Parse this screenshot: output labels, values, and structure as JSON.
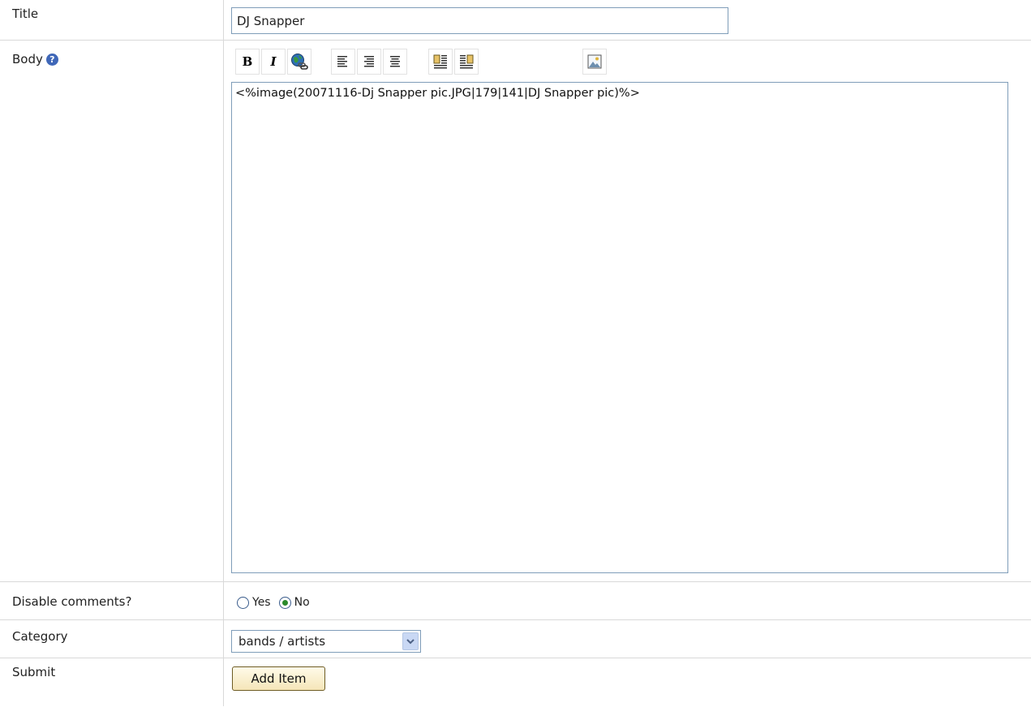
{
  "title_row": {
    "label": "Title",
    "value": "DJ Snapper"
  },
  "body_row": {
    "label": "Body",
    "help_glyph": "?",
    "toolbar": [
      {
        "name": "bold",
        "glyph": "B"
      },
      {
        "name": "italic",
        "glyph": "I"
      },
      {
        "name": "link",
        "icon": "globe-link-icon"
      },
      {
        "name": "align-left",
        "icon": "align-left-icon"
      },
      {
        "name": "align-right",
        "icon": "align-right-icon"
      },
      {
        "name": "align-center",
        "icon": "align-center-icon"
      },
      {
        "name": "float-left",
        "icon": "float-left-icon"
      },
      {
        "name": "float-right",
        "icon": "float-right-icon"
      },
      {
        "name": "insert-image",
        "icon": "image-icon"
      }
    ],
    "content": "<%image(20071116-Dj Snapper pic.JPG|179|141|DJ Snapper pic)%>"
  },
  "comments_row": {
    "label": "Disable comments?",
    "options": [
      {
        "label": "Yes",
        "checked": false
      },
      {
        "label": "No",
        "checked": true
      }
    ]
  },
  "category_row": {
    "label": "Category",
    "selected": "bands / artists"
  },
  "submit_row": {
    "label": "Submit",
    "button_label": "Add Item"
  },
  "colors": {
    "input_border": "#7f9db9",
    "divider": "#d9d9d9",
    "button_border": "#6e5c24",
    "button_fill": "#f5e5b8",
    "help_icon": "#3f67b8"
  }
}
